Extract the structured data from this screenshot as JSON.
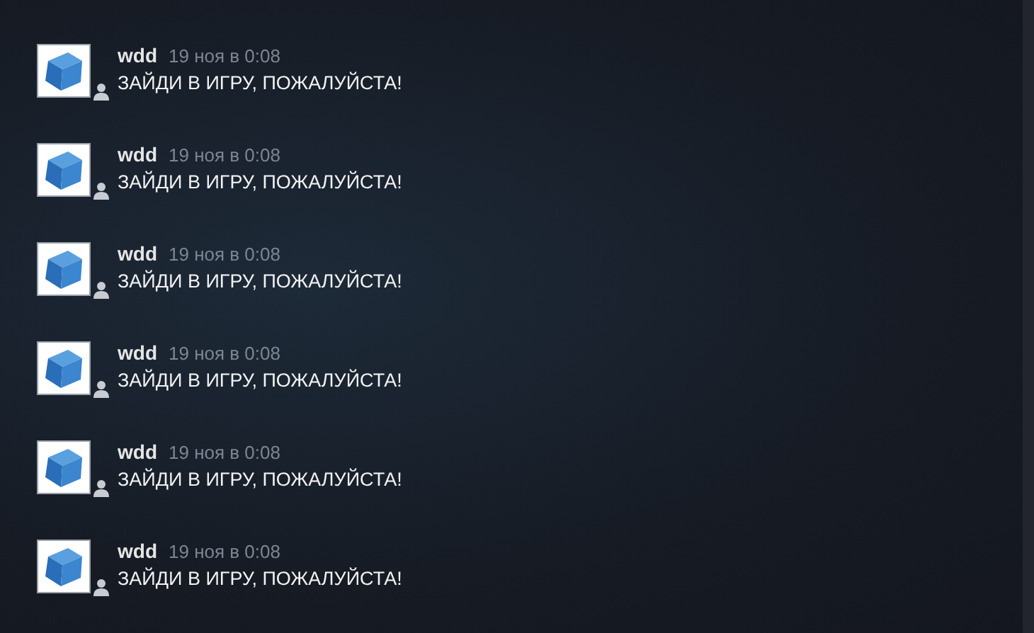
{
  "comments": [
    {
      "author": "wdd",
      "time": "19 ноя в 0:08",
      "text": "ЗАЙДИ В ИГРУ, ПОЖАЛУЙСТА!"
    },
    {
      "author": "wdd",
      "time": "19 ноя в 0:08",
      "text": "ЗАЙДИ В ИГРУ, ПОЖАЛУЙСТА!"
    },
    {
      "author": "wdd",
      "time": "19 ноя в 0:08",
      "text": "ЗАЙДИ В ИГРУ, ПОЖАЛУЙСТА!"
    },
    {
      "author": "wdd",
      "time": "19 ноя в 0:08",
      "text": "ЗАЙДИ В ИГРУ, ПОЖАЛУЙСТА!"
    },
    {
      "author": "wdd",
      "time": "19 ноя в 0:08",
      "text": "ЗАЙДИ В ИГРУ, ПОЖАЛУЙСТА!"
    },
    {
      "author": "wdd",
      "time": "19 ноя в 0:08",
      "text": "ЗАЙДИ В ИГРУ, ПОЖАЛУЙСТА!"
    }
  ]
}
